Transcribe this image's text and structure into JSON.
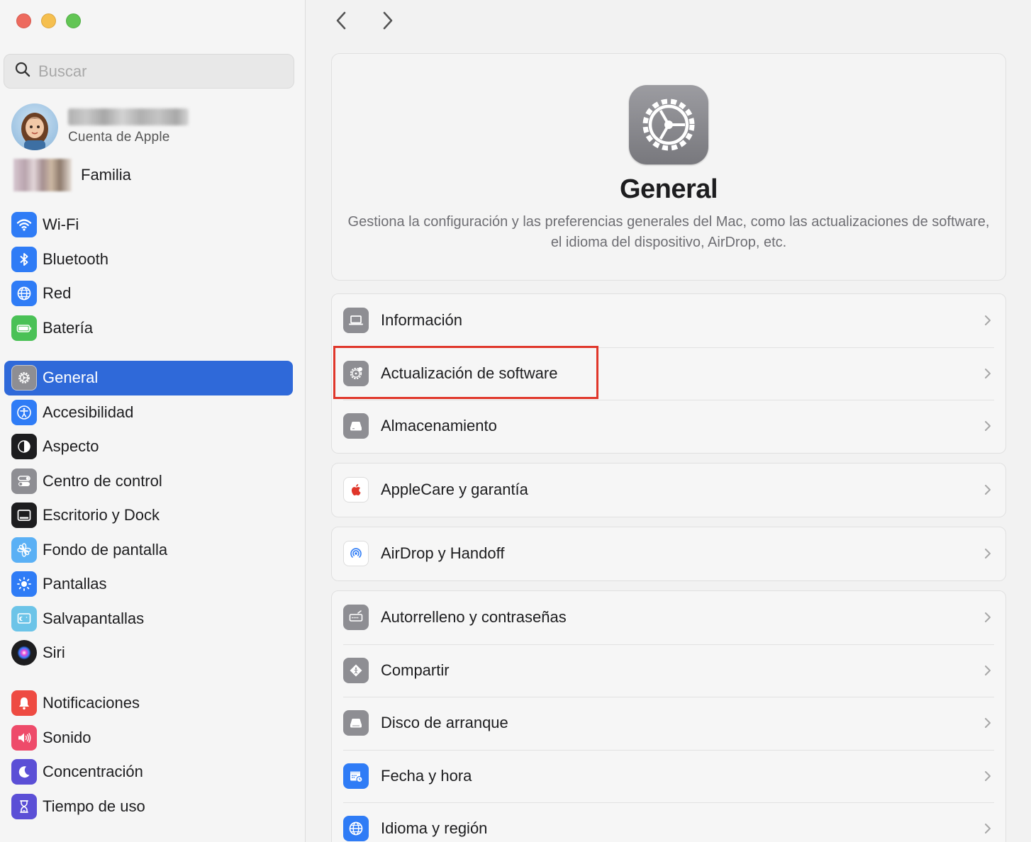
{
  "window": {
    "traffic_lights": [
      "close",
      "minimize",
      "zoom"
    ]
  },
  "sidebar": {
    "search": {
      "placeholder": "Buscar",
      "value": ""
    },
    "account": {
      "subtitle": "Cuenta de Apple"
    },
    "family": {
      "label": "Familia"
    },
    "groups": [
      [
        {
          "label": "Wi-Fi",
          "icon": "wifi-icon",
          "color": "#2f7cf6"
        },
        {
          "label": "Bluetooth",
          "icon": "bluetooth-icon",
          "color": "#2f7cf6"
        },
        {
          "label": "Red",
          "icon": "globe-icon",
          "color": "#2f7cf6"
        },
        {
          "label": "Batería",
          "icon": "battery-icon",
          "color": "#4ac156"
        }
      ],
      [
        {
          "label": "General",
          "icon": "gear-icon",
          "color": "#8e8e93",
          "active": true
        },
        {
          "label": "Accesibilidad",
          "icon": "accessibility-icon",
          "color": "#2f7cf6"
        },
        {
          "label": "Aspecto",
          "icon": "appearance-icon",
          "color": "#1d1d1f"
        },
        {
          "label": "Centro de control",
          "icon": "control-center-icon",
          "color": "#8e8e93"
        },
        {
          "label": "Escritorio y Dock",
          "icon": "dock-icon",
          "color": "#1d1d1f"
        },
        {
          "label": "Fondo de pantalla",
          "icon": "wallpaper-icon",
          "color": "#5ab0f5"
        },
        {
          "label": "Pantallas",
          "icon": "displays-icon",
          "color": "#2f7cf6"
        },
        {
          "label": "Salvapantallas",
          "icon": "screensaver-icon",
          "color": "#6cc4e8"
        },
        {
          "label": "Siri",
          "icon": "siri-icon",
          "color": "#1d1d1f"
        }
      ],
      [
        {
          "label": "Notificaciones",
          "icon": "bell-icon",
          "color": "#ee4b42"
        },
        {
          "label": "Sonido",
          "icon": "speaker-icon",
          "color": "#ee4b6a"
        },
        {
          "label": "Concentración",
          "icon": "moon-icon",
          "color": "#5b4fd6"
        },
        {
          "label": "Tiempo de uso",
          "icon": "hourglass-icon",
          "color": "#5b4fd6"
        }
      ]
    ]
  },
  "main": {
    "hero": {
      "title": "General",
      "description": "Gestiona la configuración y las preferencias generales del Mac, como las actualizaciones de software, el idioma del dispositivo, AirDrop, etc."
    },
    "groups": [
      [
        {
          "label": "Información",
          "icon": "laptop-icon"
        },
        {
          "label": "Actualización de software",
          "icon": "software-update-icon",
          "highlighted": true
        },
        {
          "label": "Almacenamiento",
          "icon": "storage-icon"
        }
      ],
      [
        {
          "label": "AppleCare y garantía",
          "icon": "apple-icon"
        }
      ],
      [
        {
          "label": "AirDrop y Handoff",
          "icon": "airdrop-icon"
        }
      ],
      [
        {
          "label": "Autorrelleno y contraseñas",
          "icon": "autofill-icon"
        },
        {
          "label": "Compartir",
          "icon": "sharing-icon"
        },
        {
          "label": "Disco de arranque",
          "icon": "startup-disk-icon"
        },
        {
          "label": "Fecha y hora",
          "icon": "calendar-clock-icon"
        },
        {
          "label": "Idioma y región",
          "icon": "language-globe-icon"
        }
      ]
    ],
    "highlight_color": "#e0362a"
  }
}
